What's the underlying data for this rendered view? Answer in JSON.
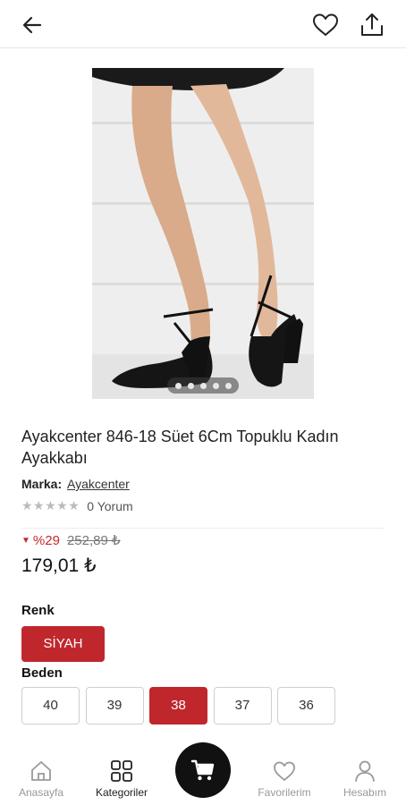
{
  "product": {
    "title": "Ayakcenter 846-18 Süet 6Cm Topuklu Kadın Ayakkabı",
    "brand_label": "Marka:",
    "brand": "Ayakcenter",
    "stars": "★★★★★",
    "reviews": "0 Yorum",
    "discount_percent": "%29",
    "old_price": "252,89 ₺",
    "price": "179,01 ₺",
    "image_count": 5,
    "image_index": 0
  },
  "color": {
    "label": "Renk",
    "selected": "SİYAH"
  },
  "size": {
    "label": "Beden",
    "options": [
      "40",
      "39",
      "38",
      "37",
      "36"
    ],
    "selected": "38"
  },
  "nav": {
    "home": "Anasayfa",
    "categories": "Kategoriler",
    "favorites": "Favorilerim",
    "account": "Hesabım"
  },
  "icons": {
    "back": "back-arrow-icon",
    "favorite": "heart-icon",
    "share": "share-icon",
    "cart": "cart-icon"
  },
  "colors": {
    "accent": "#c0272d",
    "discount": "#c62828"
  }
}
